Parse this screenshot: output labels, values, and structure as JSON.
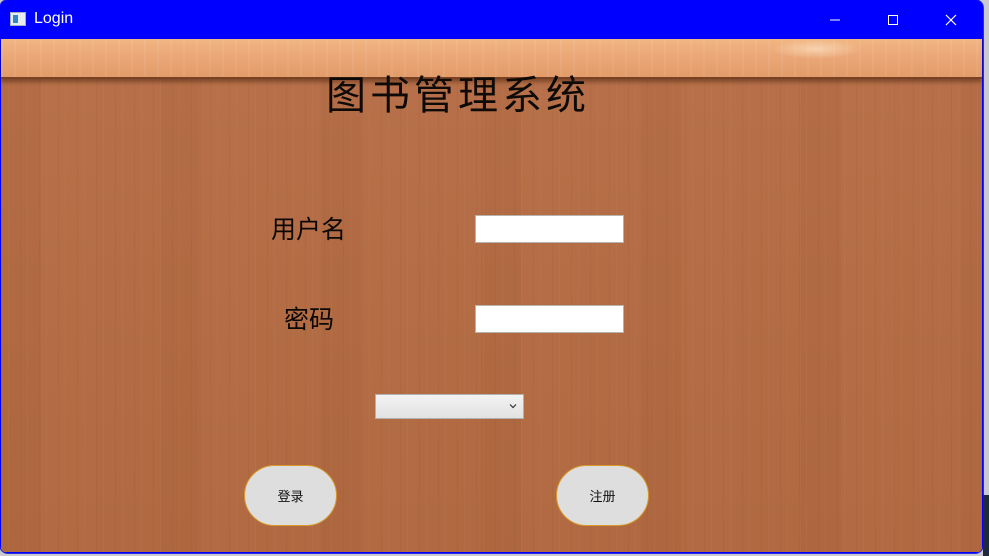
{
  "window": {
    "title": "Login",
    "title_bar_color": "#0000ff",
    "controls": {
      "minimize_icon": "minimize-icon",
      "maximize_icon": "maximize-icon",
      "close_icon": "close-icon"
    }
  },
  "form": {
    "heading": "图书管理系统",
    "username_label": "用户名",
    "username_value": "",
    "password_label": "密码",
    "password_value": "",
    "role_select_value": "",
    "login_button": "登录",
    "register_button": "注册"
  },
  "colors": {
    "wood_background": "#b36c44",
    "shelf": "#eba777",
    "button_border": "#d99a2b",
    "button_fill": "#dedede"
  }
}
